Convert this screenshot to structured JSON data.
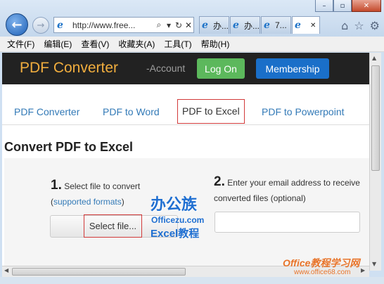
{
  "browser": {
    "window_controls": [
      "–",
      "▫",
      "✕"
    ],
    "back_glyph": "←",
    "forward_glyph": "→",
    "address": {
      "url": "http://www.free...",
      "search_glyph": "⌕",
      "dropdown_glyph": "▾",
      "refresh_glyph": "↻",
      "stop_glyph": "✕"
    },
    "tabs": [
      {
        "label": "办..."
      },
      {
        "label": "办..."
      },
      {
        "label": "7..."
      },
      {
        "label": ""
      }
    ],
    "active_tab_close": "✕",
    "chrome_icons": [
      "⌂",
      "☆",
      "⚙"
    ],
    "menu": [
      "文件(F)",
      "编辑(E)",
      "查看(V)",
      "收藏夹(A)",
      "工具(T)",
      "帮助(H)"
    ]
  },
  "site": {
    "brand": "PDF Converter",
    "account": "-Account",
    "logon": "Log On",
    "membership": "Membership",
    "tabs": [
      "PDF Converter",
      "PDF to Word",
      "PDF to Excel",
      "PDF to Powerpoint"
    ],
    "active_tab": "PDF to Excel",
    "page_title": "Convert PDF to Excel",
    "step1": {
      "number": "1.",
      "text": "Select file to convert",
      "paren_open": "(",
      "link": "supported formats",
      "paren_close": ")",
      "button": "Select file..."
    },
    "step2": {
      "number": "2.",
      "text": "Enter your email address to receive converted files (optional)",
      "input_value": ""
    }
  },
  "watermarks": {
    "logo": "办公族",
    "site": "Officezu.com",
    "excel": "Excel教程",
    "corner_main": "Office教程学习网",
    "corner_url": "www.office68.com"
  },
  "colors": {
    "brand": "#f0ad3e",
    "logon": "#5cb85c",
    "membership": "#1a6fc9",
    "link": "#337ab7",
    "highlight": "#d23a3a"
  }
}
